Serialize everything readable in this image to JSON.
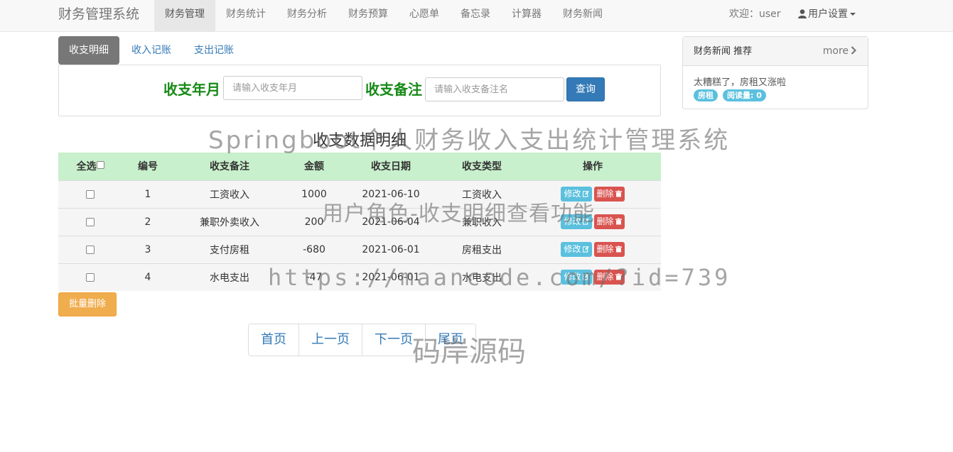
{
  "navbar": {
    "brand": "财务管理系统",
    "items": [
      {
        "label": "财务管理",
        "active": true
      },
      {
        "label": "财务统计"
      },
      {
        "label": "财务分析"
      },
      {
        "label": "财务预算"
      },
      {
        "label": "心愿单"
      },
      {
        "label": "备忘录"
      },
      {
        "label": "计算器"
      },
      {
        "label": "财务新闻"
      }
    ],
    "welcome": "欢迎：user",
    "user_settings": "用户设置",
    "icons": {
      "user": "user-icon",
      "caret": "caret-down-icon"
    }
  },
  "tabs": [
    {
      "label": "收支明细",
      "active": true
    },
    {
      "label": "收入记账"
    },
    {
      "label": "支出记账"
    }
  ],
  "search": {
    "month_label": "收支年月",
    "month_placeholder": "请输入收支年月",
    "month_value": "",
    "note_label": "收支备注",
    "note_placeholder": "请输入收支备注名",
    "note_value": "",
    "query_button": "查询"
  },
  "table": {
    "title": "收支数据明细",
    "headers": [
      "全选",
      "编号",
      "收支备注",
      "金额",
      "收支日期",
      "收支类型",
      "操作"
    ],
    "rows": [
      {
        "id": "1",
        "note": "工资收入",
        "amount": "1000",
        "date": "2021-06-10",
        "type": "工资收入"
      },
      {
        "id": "2",
        "note": "兼职外卖收入",
        "amount": "200",
        "date": "2021-06-04",
        "type": "兼职收入"
      },
      {
        "id": "3",
        "note": "支付房租",
        "amount": "-680",
        "date": "2021-06-01",
        "type": "房租支出"
      },
      {
        "id": "4",
        "note": "水电支出",
        "amount": "-47",
        "date": "2021-06-01",
        "type": "水电支出"
      }
    ],
    "edit_label": "修改",
    "delete_label": "删除",
    "colors": {
      "header_bg": "#c8f0cc",
      "edit": "#5bc0de",
      "delete": "#d9534f"
    }
  },
  "batch_delete": "批量删除",
  "pagination": [
    "首页",
    "上一页",
    "下一页",
    "尾页"
  ],
  "side_panel": {
    "title": "财务新闻 推荐",
    "more": "more",
    "news_title": "太糟糕了，房租又涨啦",
    "tag": "房租",
    "reads": "阅读量: 0"
  },
  "watermarks": {
    "line1": "Springboot个人财务收入支出统计管理系统",
    "line2": "用户角色-收支明细查看功能",
    "line3": "https://maancode.com/?id=739",
    "line4": "码岸源码"
  }
}
